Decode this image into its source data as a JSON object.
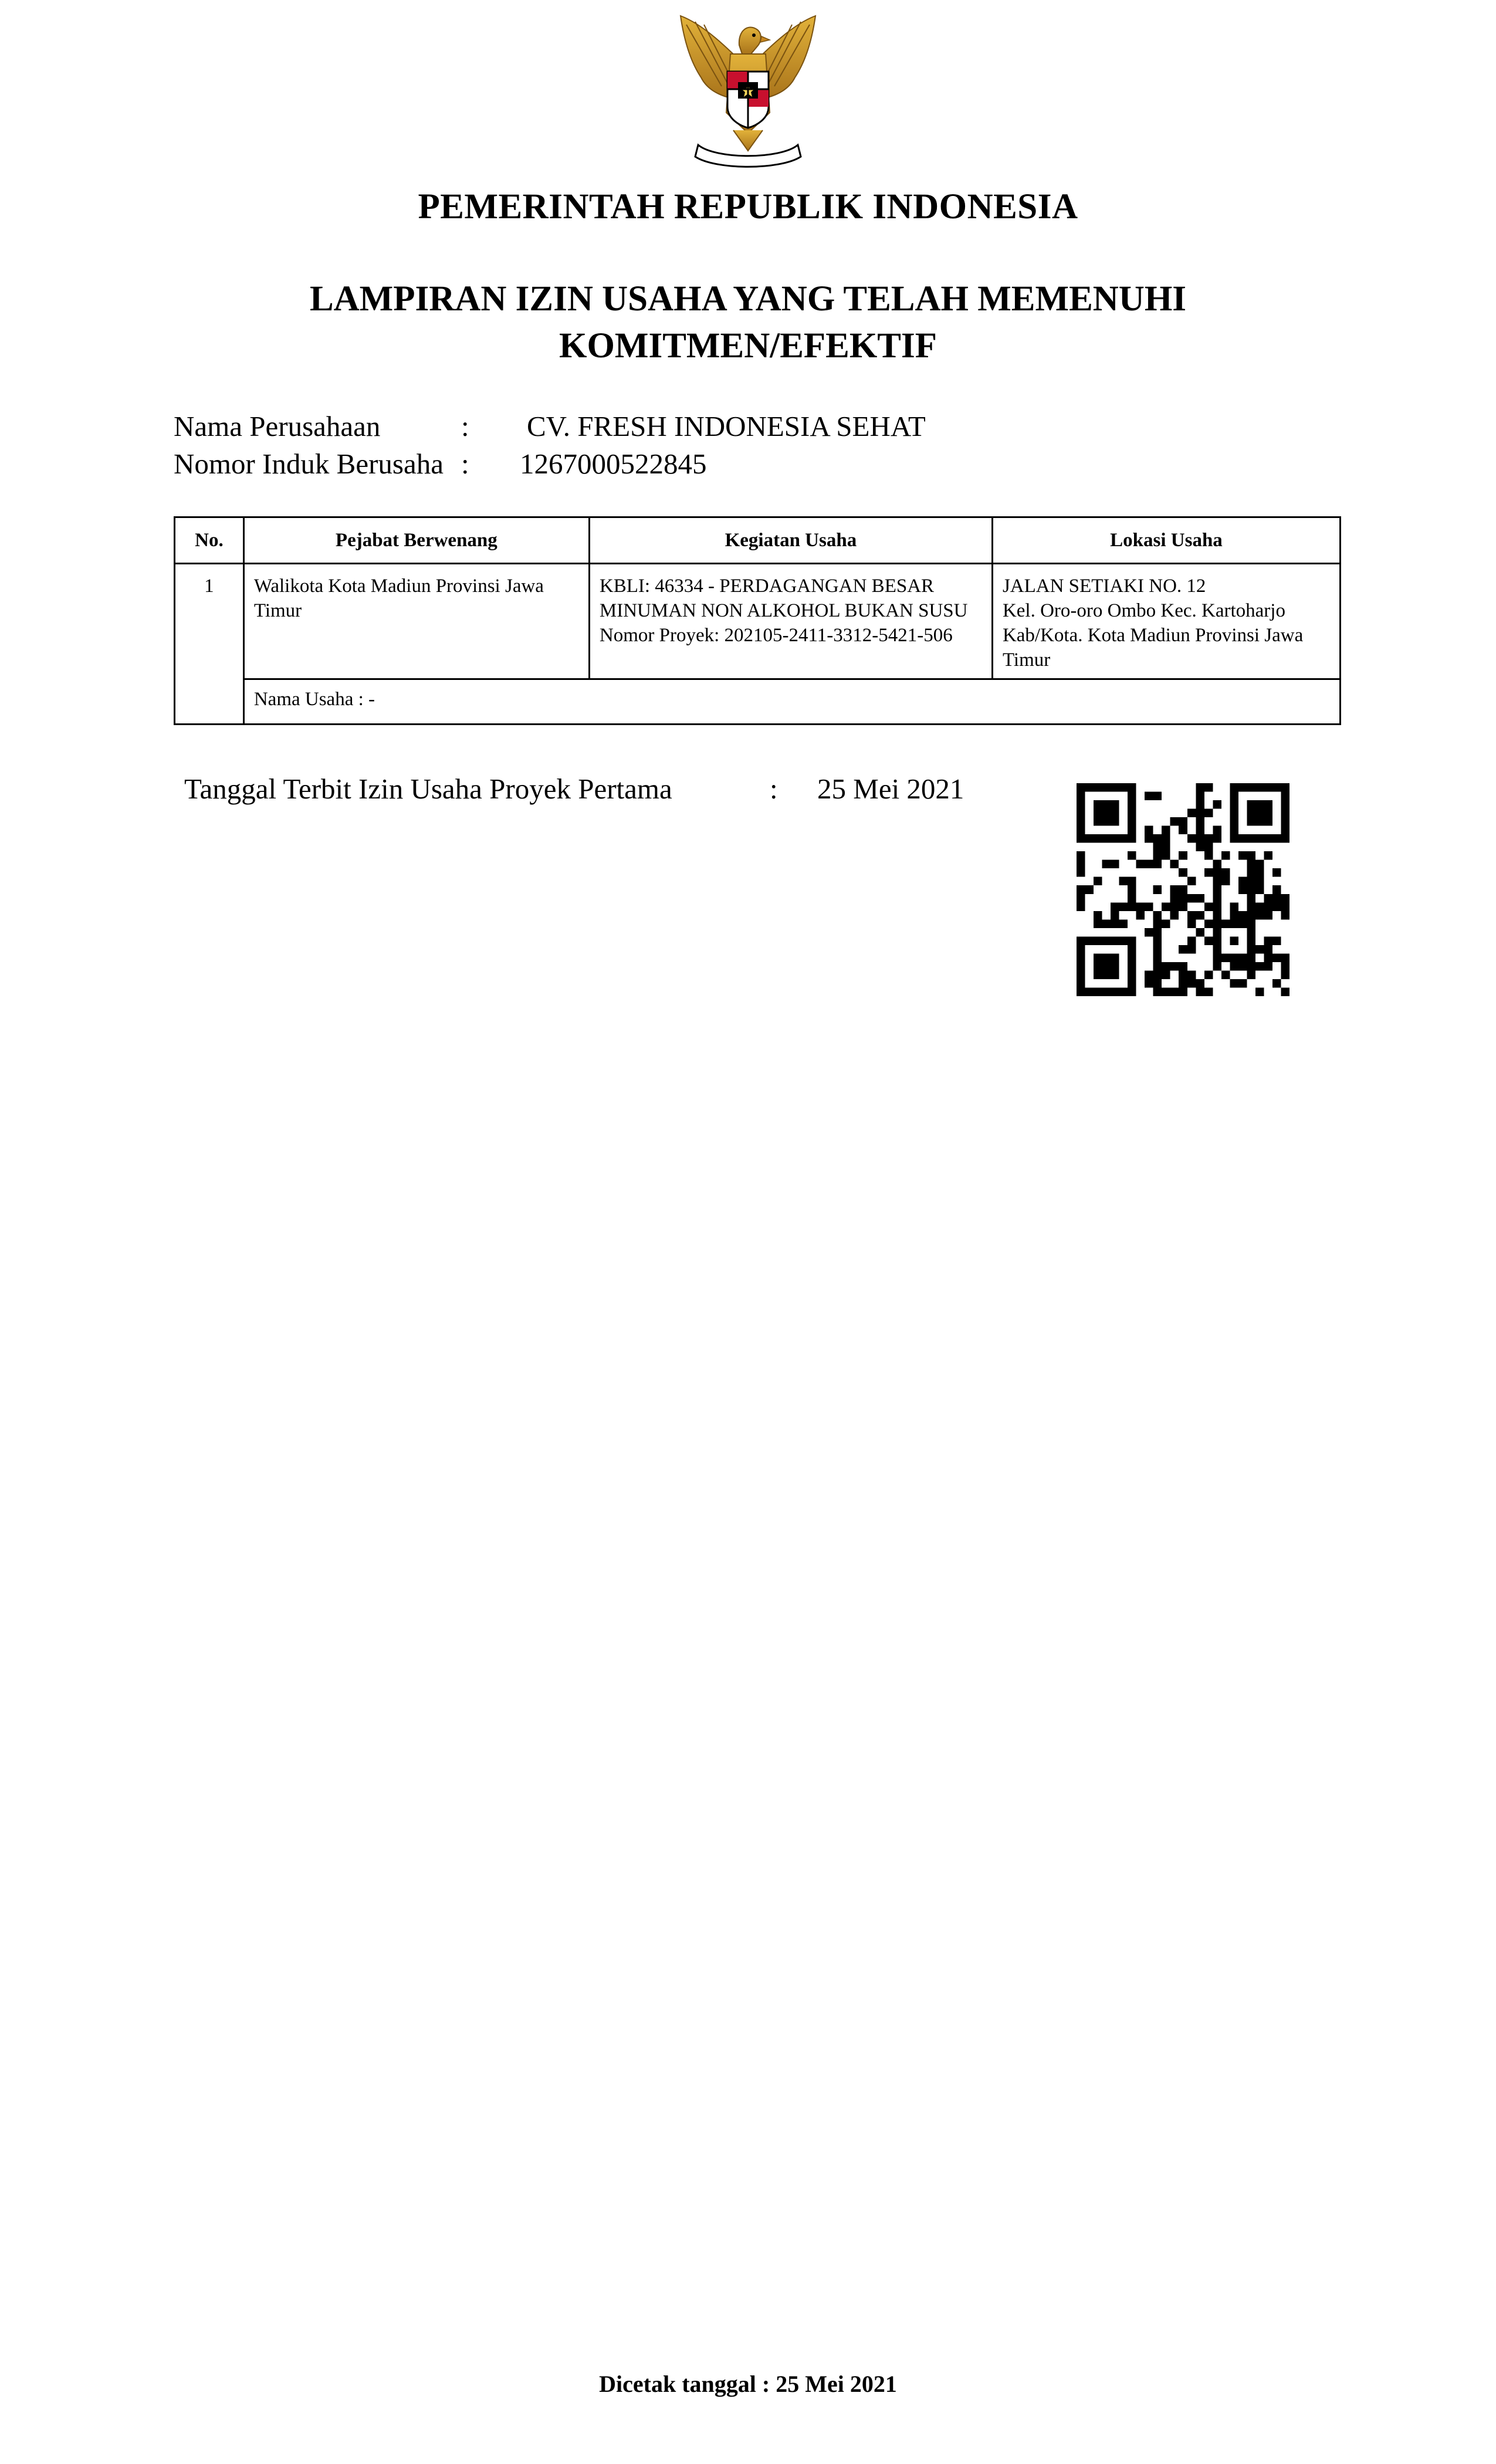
{
  "header": {
    "emblem_icon": "garuda-pancasila-emblem",
    "government": "PEMERINTAH REPUBLIK INDONESIA",
    "title_line1": "LAMPIRAN IZIN USAHA YANG TELAH MEMENUHI",
    "title_line2": "KOMITMEN/EFEKTIF"
  },
  "company": {
    "name_label": "Nama Perusahaan",
    "name_colon": ":",
    "name_value": "CV. FRESH INDONESIA SEHAT",
    "nib_label": "Nomor Induk Berusaha",
    "nib_colon": ":",
    "nib_value": "1267000522845"
  },
  "table": {
    "headers": [
      "No.",
      "Pejabat Berwenang",
      "Kegiatan Usaha",
      "Lokasi Usaha"
    ],
    "rows": [
      {
        "no": "1",
        "pejabat": "Walikota Kota Madiun Provinsi Jawa Timur",
        "kegiatan_kbli": "KBLI: 46334 - PERDAGANGAN BESAR MINUMAN NON ALKOHOL BUKAN SUSU",
        "kegiatan_proyek": "Nomor Proyek: 202105-2411-3312-5421-506",
        "lokasi_line1": "JALAN SETIAKI NO. 12",
        "lokasi_line2": "Kel. Oro-oro Ombo Kec. Kartoharjo Kab/Kota. Kota Madiun Provinsi Jawa Timur",
        "nama_usaha": "Nama Usaha : -"
      }
    ]
  },
  "issue": {
    "label": "Tanggal Terbit Izin Usaha Proyek Pertama",
    "colon": ":",
    "date": "25 Mei 2021",
    "qr_icon": "qr-code"
  },
  "footer": {
    "printed": "Dicetak tanggal : 25 Mei 2021"
  }
}
